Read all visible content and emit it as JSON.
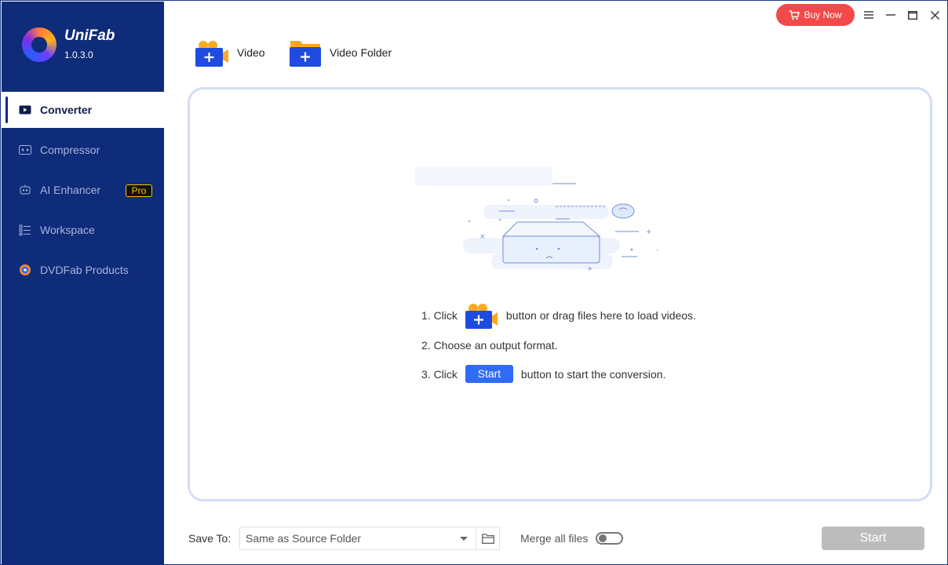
{
  "app": {
    "name": "UniFab",
    "version": "1.0.3.0"
  },
  "sidebar": {
    "items": [
      {
        "label": "Converter",
        "icon": "play-icon",
        "active": true
      },
      {
        "label": "Compressor",
        "icon": "compress-icon"
      },
      {
        "label": "AI Enhancer",
        "icon": "robot-icon",
        "badge": "Pro"
      },
      {
        "label": "Workspace",
        "icon": "list-icon"
      },
      {
        "label": "DVDFab Products",
        "icon": "dvdfab-icon"
      }
    ]
  },
  "topbar": {
    "buy_now_label": "Buy Now"
  },
  "toolbar": {
    "video_label": "Video",
    "video_folder_label": "Video Folder"
  },
  "dropzone": {
    "step1_prefix": "1. Click",
    "step1_suffix": "button or drag files here to load videos.",
    "step2": "2. Choose an output format.",
    "step3_prefix": "3. Click",
    "step3_chip": "Start",
    "step3_suffix": "button to start the conversion."
  },
  "bottom": {
    "save_to_label": "Save To:",
    "save_to_value": "Same as Source Folder",
    "merge_label": "Merge all files",
    "merge_enabled": false,
    "start_label": "Start"
  },
  "colors": {
    "sidebar": "#0e2c7a",
    "accent": "#2f6bf5",
    "buy_now": "#f24a4a",
    "disabled": "#bcbcbc"
  }
}
